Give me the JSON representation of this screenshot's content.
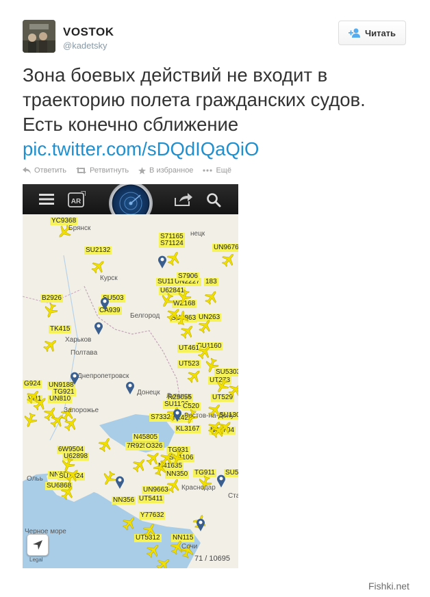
{
  "author": {
    "name": "VOSTOK",
    "handle": "@kadetsky"
  },
  "follow_button": {
    "label": "Читать"
  },
  "tweet": {
    "text": "Зона боевых действий не входит в траекторию полета гражданских судов. Есть конечно сближение",
    "link": "pic.twitter.com/sDQdIQaQiO"
  },
  "actions": [
    {
      "label": "Ответить",
      "icon": "reply-icon"
    },
    {
      "label": "Ретвитнуть",
      "icon": "retweet-icon"
    },
    {
      "label": "В избранное",
      "icon": "favorite-star-icon"
    },
    {
      "label": "Ещё",
      "icon": "more-dots-icon"
    }
  ],
  "app": {
    "counter": "71 / 10695",
    "legal": "Legal",
    "colors": {
      "label_bg": "#f6f35a",
      "plane": "#f2e000",
      "pin": "#3a5f8f",
      "map_bg": "#f2efe6",
      "sea": "#aacde7"
    }
  },
  "flight_labels": [
    "YC9368",
    "SU2132",
    "S71165",
    "S71124",
    "UN9676",
    "SU503",
    "CA939",
    "B2926",
    "SU11",
    "UN2227",
    "183",
    "U62841",
    "WZ168",
    "SU6863",
    "UN263",
    "TK415",
    "SU1160",
    "UT461",
    "UT523",
    "SU5303",
    "UT273",
    "G924",
    "UN9188",
    "TG921",
    "VN1",
    "UN810",
    "UT529",
    "R25055",
    "SU1126",
    "C520",
    "S7332",
    "TK422",
    "KL3167",
    "SU1302",
    "N41704",
    "N45805",
    "7R925",
    "O326",
    "TG931",
    "SU1106",
    "6W9504",
    "U62898",
    "N41635",
    "NN350",
    "TG911",
    "NN35",
    "SU1824",
    "SU6868",
    "UN9663",
    "NN356",
    "UT5411",
    "Y77632",
    "UT5312",
    "NN115",
    "SU5",
    "S7906"
  ],
  "cities": [
    "Брянск",
    "Курск",
    "Белгород",
    "Харьков",
    "Полтава",
    "Днепропетровск",
    "Донецк",
    "Луганск",
    "Запорожье",
    "Ростов-на-Дону",
    "Краснодар",
    "Черное море",
    "Ста",
    "Сочи",
    "Ольь",
    "нецк"
  ],
  "watermark": "Fishki.net"
}
